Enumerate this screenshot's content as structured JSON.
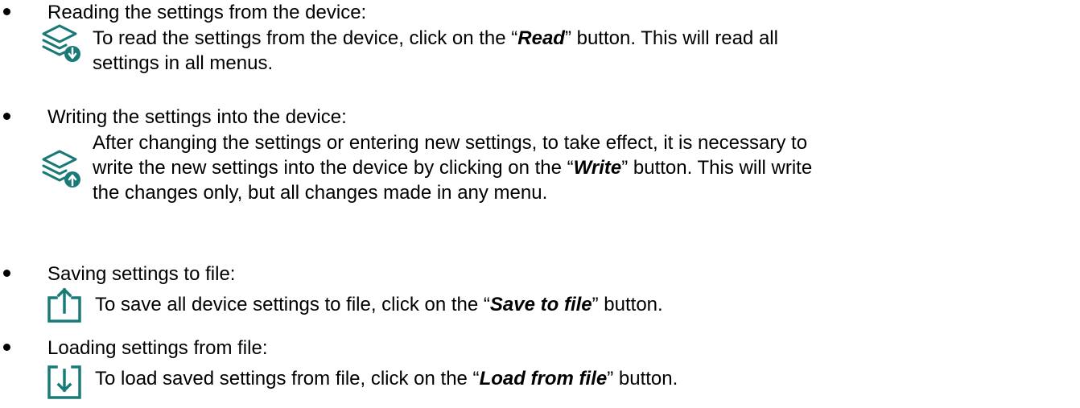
{
  "items": [
    {
      "heading": "Reading the settings from the device:",
      "icon": "layers-download-icon",
      "lines": [
        {
          "pre": "To read the settings from the device, click on the “",
          "em": "Read",
          "post": "” button. This will read all"
        },
        {
          "pre": "settings in all menus.",
          "em": "",
          "post": ""
        }
      ]
    },
    {
      "heading": "Writing the settings into the device:",
      "icon": "layers-upload-icon",
      "lines": [
        {
          "pre": "After changing the settings or entering new settings, to take effect, it is necessary to",
          "em": "",
          "post": ""
        },
        {
          "pre": "write the new settings into the device by clicking on the “",
          "em": "Write",
          "post": "” button. This will write"
        },
        {
          "pre": "the changes only, but all changes made in any menu.",
          "em": "",
          "post": ""
        }
      ]
    },
    {
      "heading": "Saving settings to file:",
      "icon": "save-to-file-icon",
      "lines": [
        {
          "pre": "To save all device settings to file, click on the “",
          "em": "Save to file",
          "post": "” button."
        }
      ]
    },
    {
      "heading": "Loading settings from file:",
      "icon": "load-from-file-icon",
      "lines": [
        {
          "pre": "To load saved settings from file, click on the “",
          "em": "Load from file",
          "post": "” button."
        }
      ]
    }
  ],
  "colors": {
    "icon": "#1a7a78",
    "text": "#000000"
  }
}
